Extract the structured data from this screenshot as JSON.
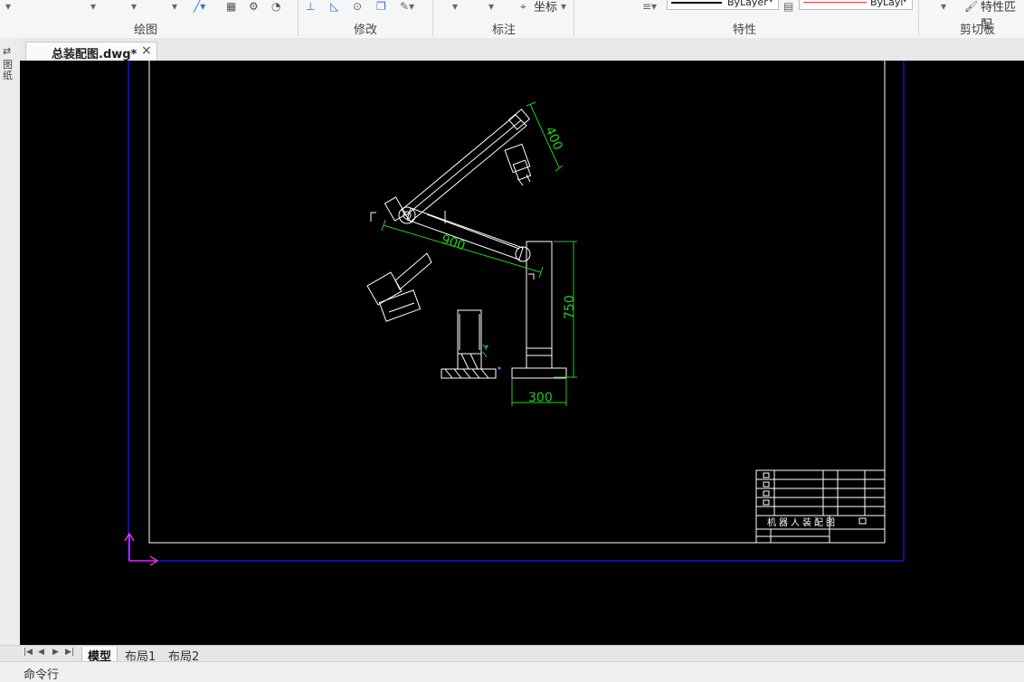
{
  "ribbon": {
    "groups": {
      "draw": "绘图",
      "modify": "修改",
      "annotate": "标注",
      "properties": "特性",
      "clipboard": "剪切板"
    },
    "coord_label": "坐标",
    "layer_color_value": "ByLayer",
    "layer_linetype_value": "ByLayl",
    "match_prop_label": "特性匹配"
  },
  "document_tab": {
    "title": "总装配图.dwg*",
    "close": "×"
  },
  "left_bar": {
    "label": "图纸"
  },
  "drawing": {
    "dimensions": {
      "upper_arm": "400",
      "lower_arm": "900",
      "column": "750",
      "base": "300"
    },
    "title_block": {
      "name": "机器人装配图"
    }
  },
  "layout_tabs": [
    "模型",
    "布局1",
    "布局2"
  ],
  "command_line": {
    "label": "命令行"
  },
  "colors": {
    "canvas": "#000000",
    "border_blue": "#1a1aff",
    "dim_green": "#22cc22",
    "ucs_magenta": "#ff33ff",
    "accent_red": "#ff3333"
  }
}
